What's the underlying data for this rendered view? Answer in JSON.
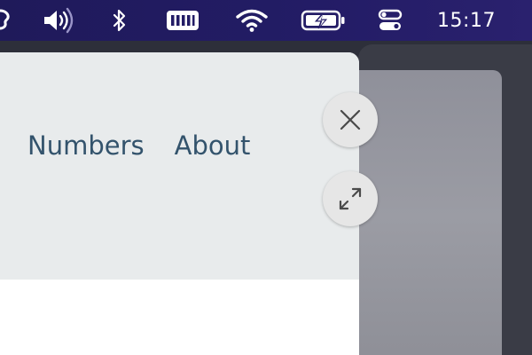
{
  "menubar": {
    "icons": {
      "app": "partial-app-icon",
      "volume": "speaker-volume-icon",
      "bluetooth": "bluetooth-icon",
      "keyboard": "keyboard-icon",
      "wifi": "wifi-icon",
      "battery": "battery-charging-icon",
      "control_center": "control-center-icon"
    },
    "clock": "15:17"
  },
  "nav": {
    "items": [
      {
        "label": "Numbers"
      },
      {
        "label": "About"
      }
    ]
  },
  "overlay_controls": {
    "close_icon": "close-icon",
    "expand_icon": "expand-icon"
  },
  "colors": {
    "menubar": "#231c66",
    "nav_link": "#33536c",
    "header_bg": "#e8ebec"
  }
}
